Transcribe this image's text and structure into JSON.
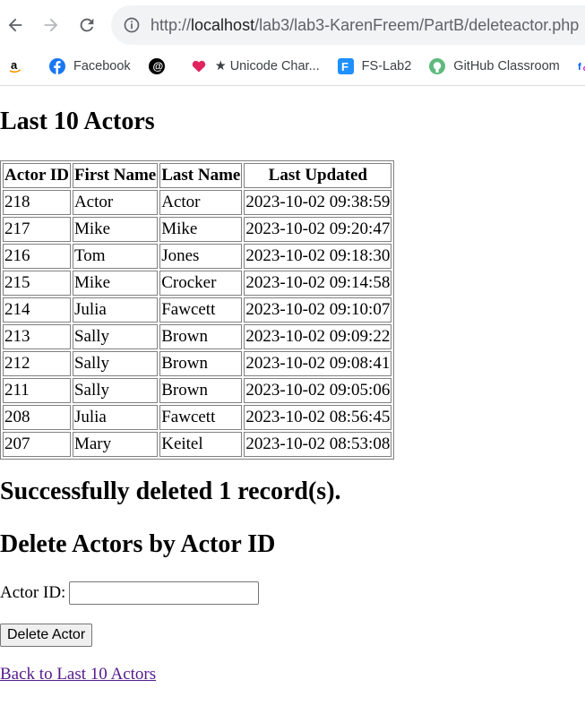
{
  "browser": {
    "url_scheme": "http://",
    "url_host": "localhost",
    "url_path": "/lab3/lab3-KarenFreem/PartB/deleteactor.php",
    "bookmarks": [
      {
        "label": "",
        "icon": "amazon-icon"
      },
      {
        "label": "Facebook",
        "icon": "facebook-icon"
      },
      {
        "label": "",
        "icon": "threads-icon"
      },
      {
        "label": "★ Unicode Char...",
        "icon": "heart-icon"
      },
      {
        "label": "FS-Lab2",
        "icon": "fs-icon"
      },
      {
        "label": "GitHub Classroom",
        "icon": "github-icon"
      },
      {
        "label": "",
        "icon": "fcc-icon"
      }
    ]
  },
  "page": {
    "title": "Last 10 Actors",
    "table": {
      "headers": [
        "Actor ID",
        "First Name",
        "Last Name",
        "Last Updated"
      ],
      "rows": [
        [
          "218",
          "Actor",
          "Actor",
          "2023-10-02 09:38:59"
        ],
        [
          "217",
          "Mike",
          "Mike",
          "2023-10-02 09:20:47"
        ],
        [
          "216",
          "Tom",
          "Jones",
          "2023-10-02 09:18:30"
        ],
        [
          "215",
          "Mike",
          "Crocker",
          "2023-10-02 09:14:58"
        ],
        [
          "214",
          "Julia",
          "Fawcett",
          "2023-10-02 09:10:07"
        ],
        [
          "213",
          "Sally",
          "Brown",
          "2023-10-02 09:09:22"
        ],
        [
          "212",
          "Sally",
          "Brown",
          "2023-10-02 09:08:41"
        ],
        [
          "211",
          "Sally",
          "Brown",
          "2023-10-02 09:05:06"
        ],
        [
          "208",
          "Julia",
          "Fawcett",
          "2023-10-02 08:56:45"
        ],
        [
          "207",
          "Mary",
          "Keitel",
          "2023-10-02 08:53:08"
        ]
      ]
    },
    "message": "Successfully deleted 1 record(s).",
    "delete_title": "Delete Actors by Actor ID",
    "form": {
      "label": "Actor ID:",
      "value": "",
      "button": "Delete Actor"
    },
    "back_link": "Back to Last 10 Actors"
  }
}
